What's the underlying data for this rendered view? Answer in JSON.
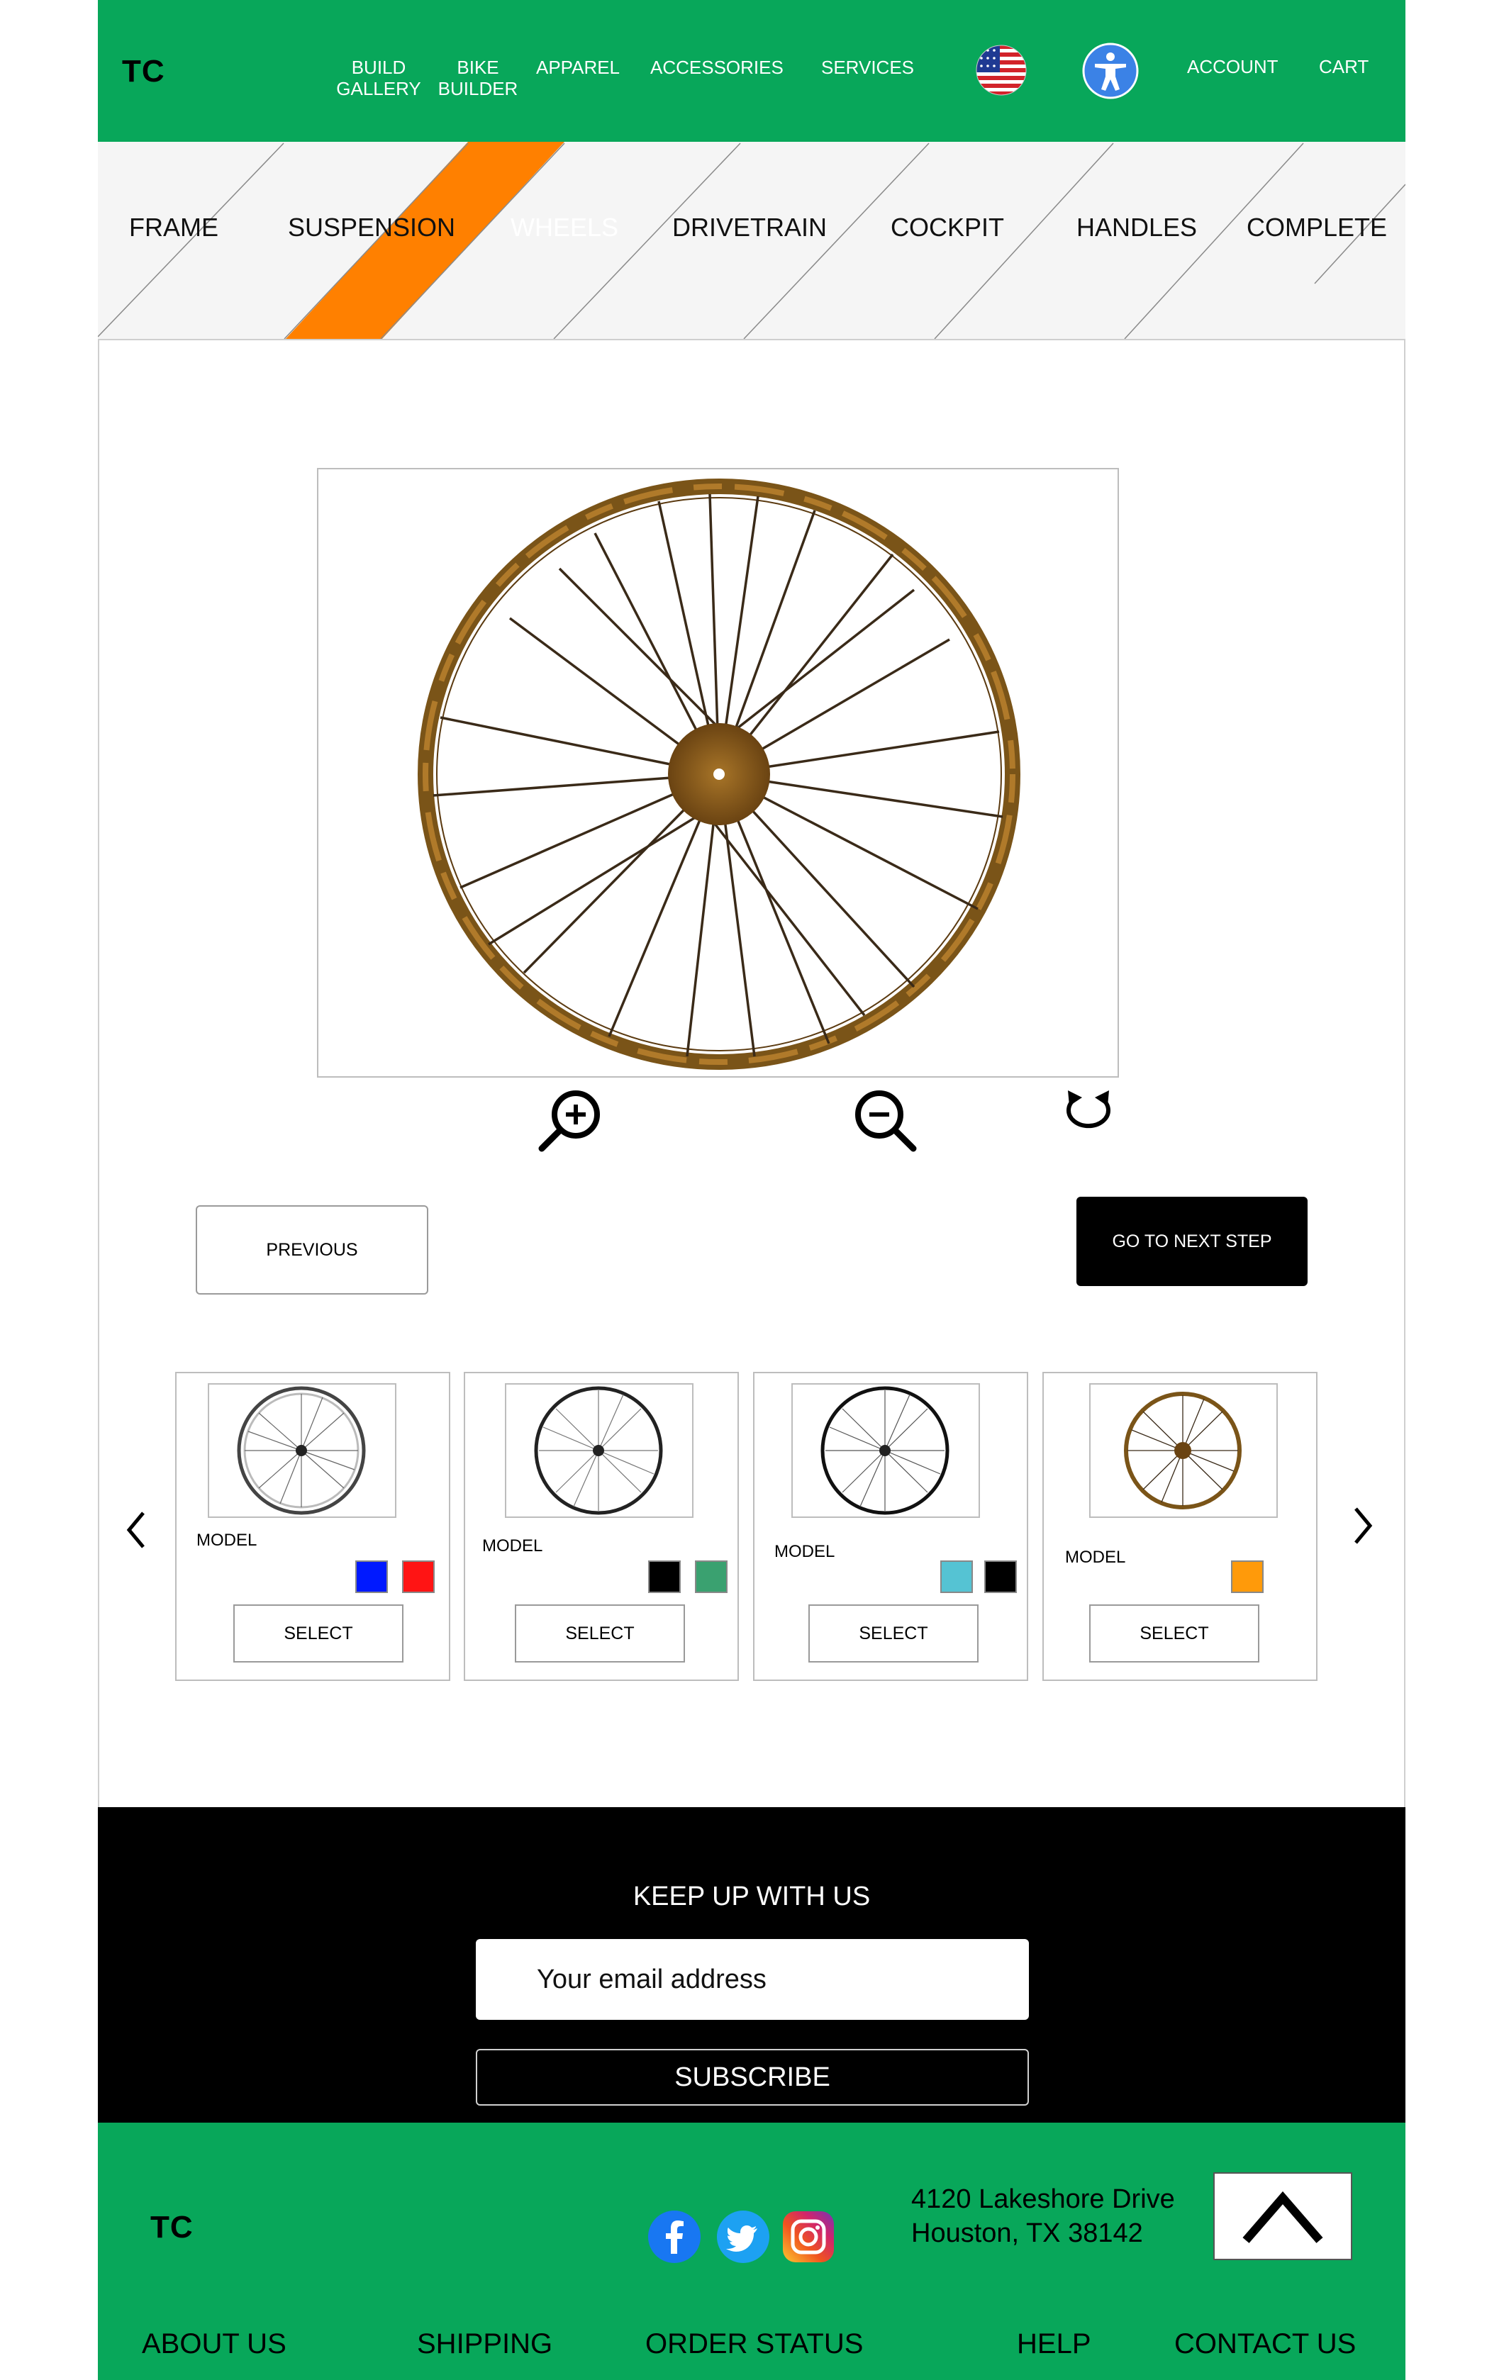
{
  "brand": {
    "logo": "TC"
  },
  "header": {
    "nav": [
      {
        "id": "build-gallery",
        "label": "BUILD\nGALLERY"
      },
      {
        "id": "bike-builder",
        "label": "BIKE\nBUILDER"
      },
      {
        "id": "apparel",
        "label": "APPAREL"
      },
      {
        "id": "accessories",
        "label": "ACCESSORIES"
      },
      {
        "id": "services",
        "label": "SERVICES"
      },
      {
        "id": "account",
        "label": "ACCOUNT"
      },
      {
        "id": "cart",
        "label": "CART"
      }
    ],
    "icons": [
      "us-flag-icon",
      "accessibility-icon"
    ]
  },
  "steps": {
    "items": [
      "FRAME",
      "SUSPENSION",
      "WHEELS",
      "DRIVETRAIN",
      "COCKPIT",
      "HANDLES",
      "COMPLETE"
    ],
    "active": "WHEELS",
    "active_color": "#ff8000"
  },
  "viewer": {
    "tools": [
      "zoom-in-icon",
      "zoom-out-icon",
      "rotate-icon"
    ]
  },
  "actions": {
    "previous_label": "PREVIOUS",
    "next_label": "GO TO NEXT STEP"
  },
  "products": [
    {
      "model": "MODEL",
      "select": "SELECT",
      "swatches": [
        "#0019ff",
        "#ff1414"
      ],
      "rim": "#333333",
      "wheel": "silver"
    },
    {
      "model": "MODEL",
      "select": "SELECT",
      "swatches": [
        "#000000",
        "#3aa170"
      ],
      "rim": "#222222",
      "wheel": "black"
    },
    {
      "model": "MODEL",
      "select": "SELECT",
      "swatches": [
        "#55c3d3",
        "#000000"
      ],
      "rim": "#111111",
      "wheel": "black"
    },
    {
      "model": "MODEL",
      "select": "SELECT",
      "swatches": [
        "#ff9a0a"
      ],
      "rim": "#7a5418",
      "wheel": "rust"
    }
  ],
  "newsletter": {
    "title": "KEEP UP WITH US",
    "email_placeholder": "Your email address",
    "subscribe_label": "SUBSCRIBE"
  },
  "footer": {
    "logo": "TC",
    "address_line1": "4120 Lakeshore Drive",
    "address_line2": "Houston, TX 38142",
    "social": [
      "facebook-icon",
      "twitter-icon",
      "instagram-icon"
    ],
    "links": [
      "ABOUT US",
      "SHIPPING",
      "ORDER STATUS",
      "HELP",
      "CONTACT US"
    ]
  },
  "colors": {
    "brand_green": "#08a75a",
    "accent_orange": "#ff8000"
  }
}
